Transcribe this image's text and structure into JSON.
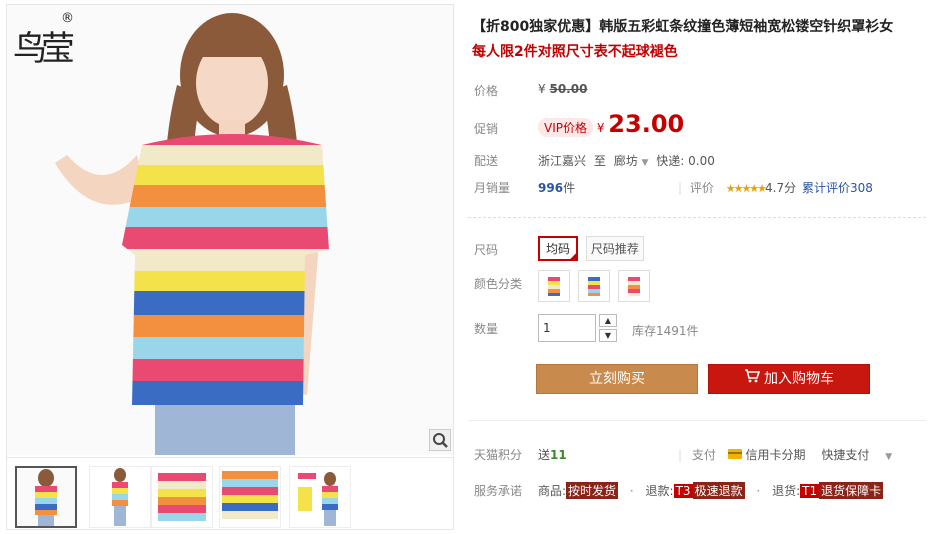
{
  "brand": {
    "logo_text": "鸟莹",
    "registered": "®"
  },
  "product": {
    "title": "【折800独家优惠】韩版五彩虹条纹撞色薄短袖宽松镂空针织罩衫女",
    "subtitle": "每人限2件对照尺寸表不起球褪色"
  },
  "price": {
    "list_label": "价格",
    "currency": "¥",
    "list_price": "50.00",
    "promo_label": "促销",
    "vip_badge": "VIP价格",
    "promo_price": "23.00"
  },
  "shipping": {
    "label": "配送",
    "from": "浙江嘉兴",
    "to_word": "至",
    "dest": "廊坊",
    "fee": "快递: 0.00"
  },
  "sales": {
    "label": "月销量",
    "count": "996",
    "unit": "件",
    "rating_label": "评价",
    "stars": "★★★★★",
    "score": "4.7分",
    "reviews": "累计评价308"
  },
  "options": {
    "size_label": "尺码",
    "size_value": "均码",
    "size_recommend": "尺码推荐",
    "color_label": "颜色分类",
    "qty_label": "数量",
    "qty_value": "1",
    "stock": "库存1491件"
  },
  "actions": {
    "buy_now": "立刻购买",
    "add_cart": "加入购物车"
  },
  "points": {
    "label": "天猫积分",
    "send": "送",
    "amount": "11",
    "pay_label": "支付",
    "credit": "信用卡分期",
    "quick_pay": "快捷支付"
  },
  "service": {
    "label": "服务承诺",
    "goods": "商品:",
    "goods_tag": "按时发货",
    "refund": "退款:",
    "refund_tag_code": "T3",
    "refund_tag": "极速退款",
    "return": "退货:",
    "return_tag_code": "T1",
    "return_tag": "退货保障卡"
  },
  "colors": {
    "accent_red": "#c40000",
    "buy_button": "#c98a4e",
    "cart_button": "#c8170e"
  }
}
